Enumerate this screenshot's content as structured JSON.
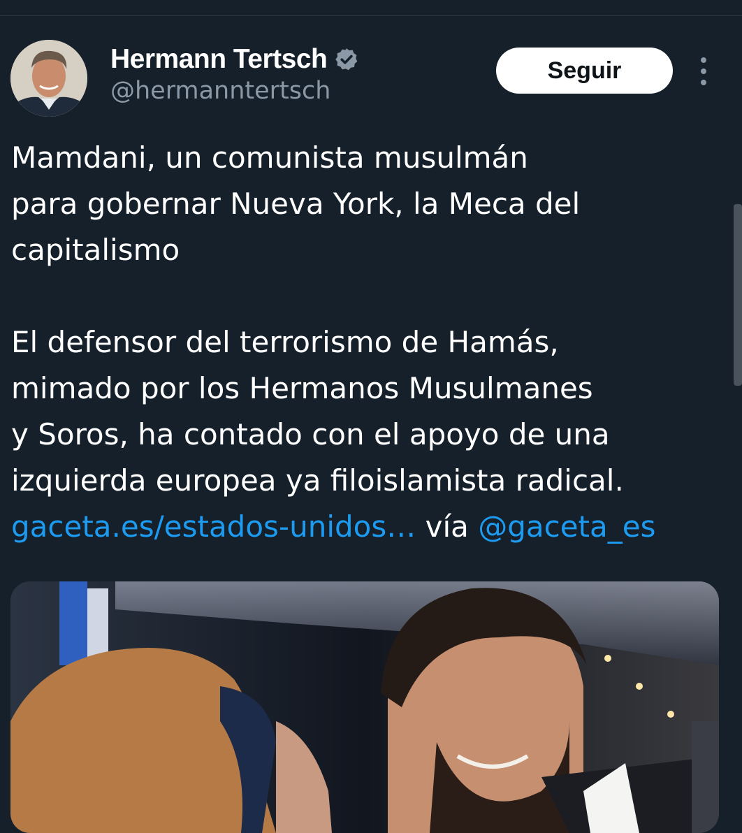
{
  "tweet": {
    "author": {
      "display_name": "Hermann Tertsch",
      "handle": "@hermanntertsch",
      "verified_icon": "verified-badge-icon"
    },
    "follow_label": "Seguir",
    "more_icon": "more-vertical-icon",
    "text": {
      "p1_line1": "Mamdani, un comunista musulmán",
      "p1_line2": "para gobernar Nueva York, la Meca del",
      "p1_line3": "capitalismo",
      "p2_line1": "El defensor del terrorismo de Hamás,",
      "p2_line2": "mimado por los Hermanos Musulmanes",
      "p2_line3": "y Soros, ha contado con el apoyo de una",
      "p2_line4": "izquierda europea ya filoislamista radical.",
      "link_url": "gaceta.es/estados-unidos…",
      "via_text": " vía ",
      "via_mention": "@gaceta_es"
    }
  },
  "colors": {
    "background": "#15202b",
    "text_primary": "#ffffff",
    "text_secondary": "#8b98a5",
    "link": "#1d9bf0",
    "button_bg": "#ffffff",
    "button_text": "#0f1419"
  }
}
